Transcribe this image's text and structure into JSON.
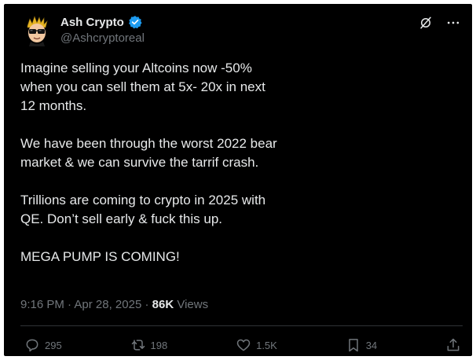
{
  "author": {
    "display_name": "Ash Crypto",
    "handle": "@Ashcryptoreal",
    "avatar_icon": "cartoon-face-with-sunglasses",
    "verified_color": "#1d9bf0"
  },
  "header": {
    "grok_icon": "grok-icon",
    "more_icon": "more-horizontal-icon"
  },
  "tweet": {
    "paragraphs": [
      "Imagine selling your Altcoins now -50% when you can sell them at 5x- 20x in next 12 months.",
      "We have been through the worst 2022 bear market & we can survive the tarrif crash.",
      "Trillions are coming to crypto in 2025 with QE. Don’t sell early & fuck this up.",
      "MEGA PUMP IS COMING!"
    ],
    "time": "9:16 PM",
    "separator": "·",
    "date": "Apr 28, 2025",
    "views_count": "86K",
    "views_label": "Views"
  },
  "actions": {
    "replies": "295",
    "reposts": "198",
    "likes": "1.5K",
    "bookmarks": "34"
  },
  "colors": {
    "background": "#000000",
    "text": "#e7e9ea",
    "muted": "#71767b",
    "divider": "#2f3336"
  }
}
